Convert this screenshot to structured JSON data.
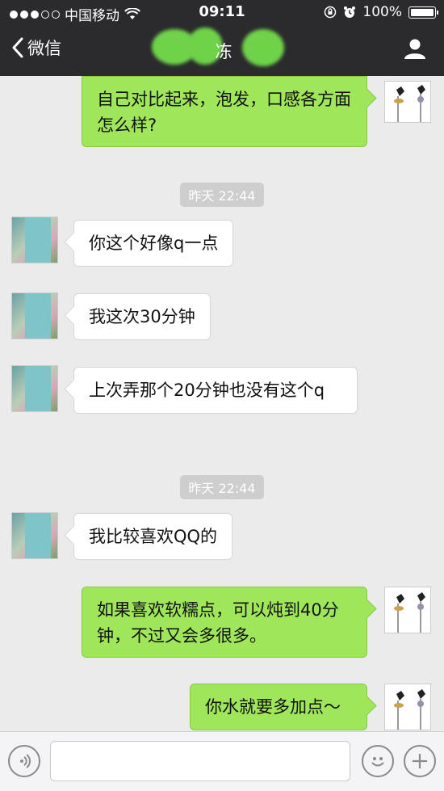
{
  "status_bar": {
    "carrier": "中国移动",
    "time": "09:11",
    "battery": "100%"
  },
  "nav": {
    "back_label": "微信",
    "title": "冻"
  },
  "messages": [
    {
      "side": "out",
      "text": "自己对比起来，泡发，口感各方面怎么样?"
    },
    {
      "side": "time",
      "text": "昨天 22:44"
    },
    {
      "side": "in",
      "text": "你这个好像q一点"
    },
    {
      "side": "in",
      "text": "我这次30分钟"
    },
    {
      "side": "in",
      "text": "上次弄那个20分钟也没有这个q"
    },
    {
      "side": "time",
      "text": "昨天 22:44"
    },
    {
      "side": "in",
      "text": "我比较喜欢QQ的"
    },
    {
      "side": "out",
      "text": "如果喜欢软糯点，可以炖到40分钟，不过又会多很多。"
    },
    {
      "side": "out",
      "text": "你水就要多加点～"
    }
  ],
  "input": {
    "placeholder": ""
  },
  "colors": {
    "outgoing_bubble": "#9fe65b",
    "header": "#2b2b2e",
    "background": "#ebebeb"
  }
}
